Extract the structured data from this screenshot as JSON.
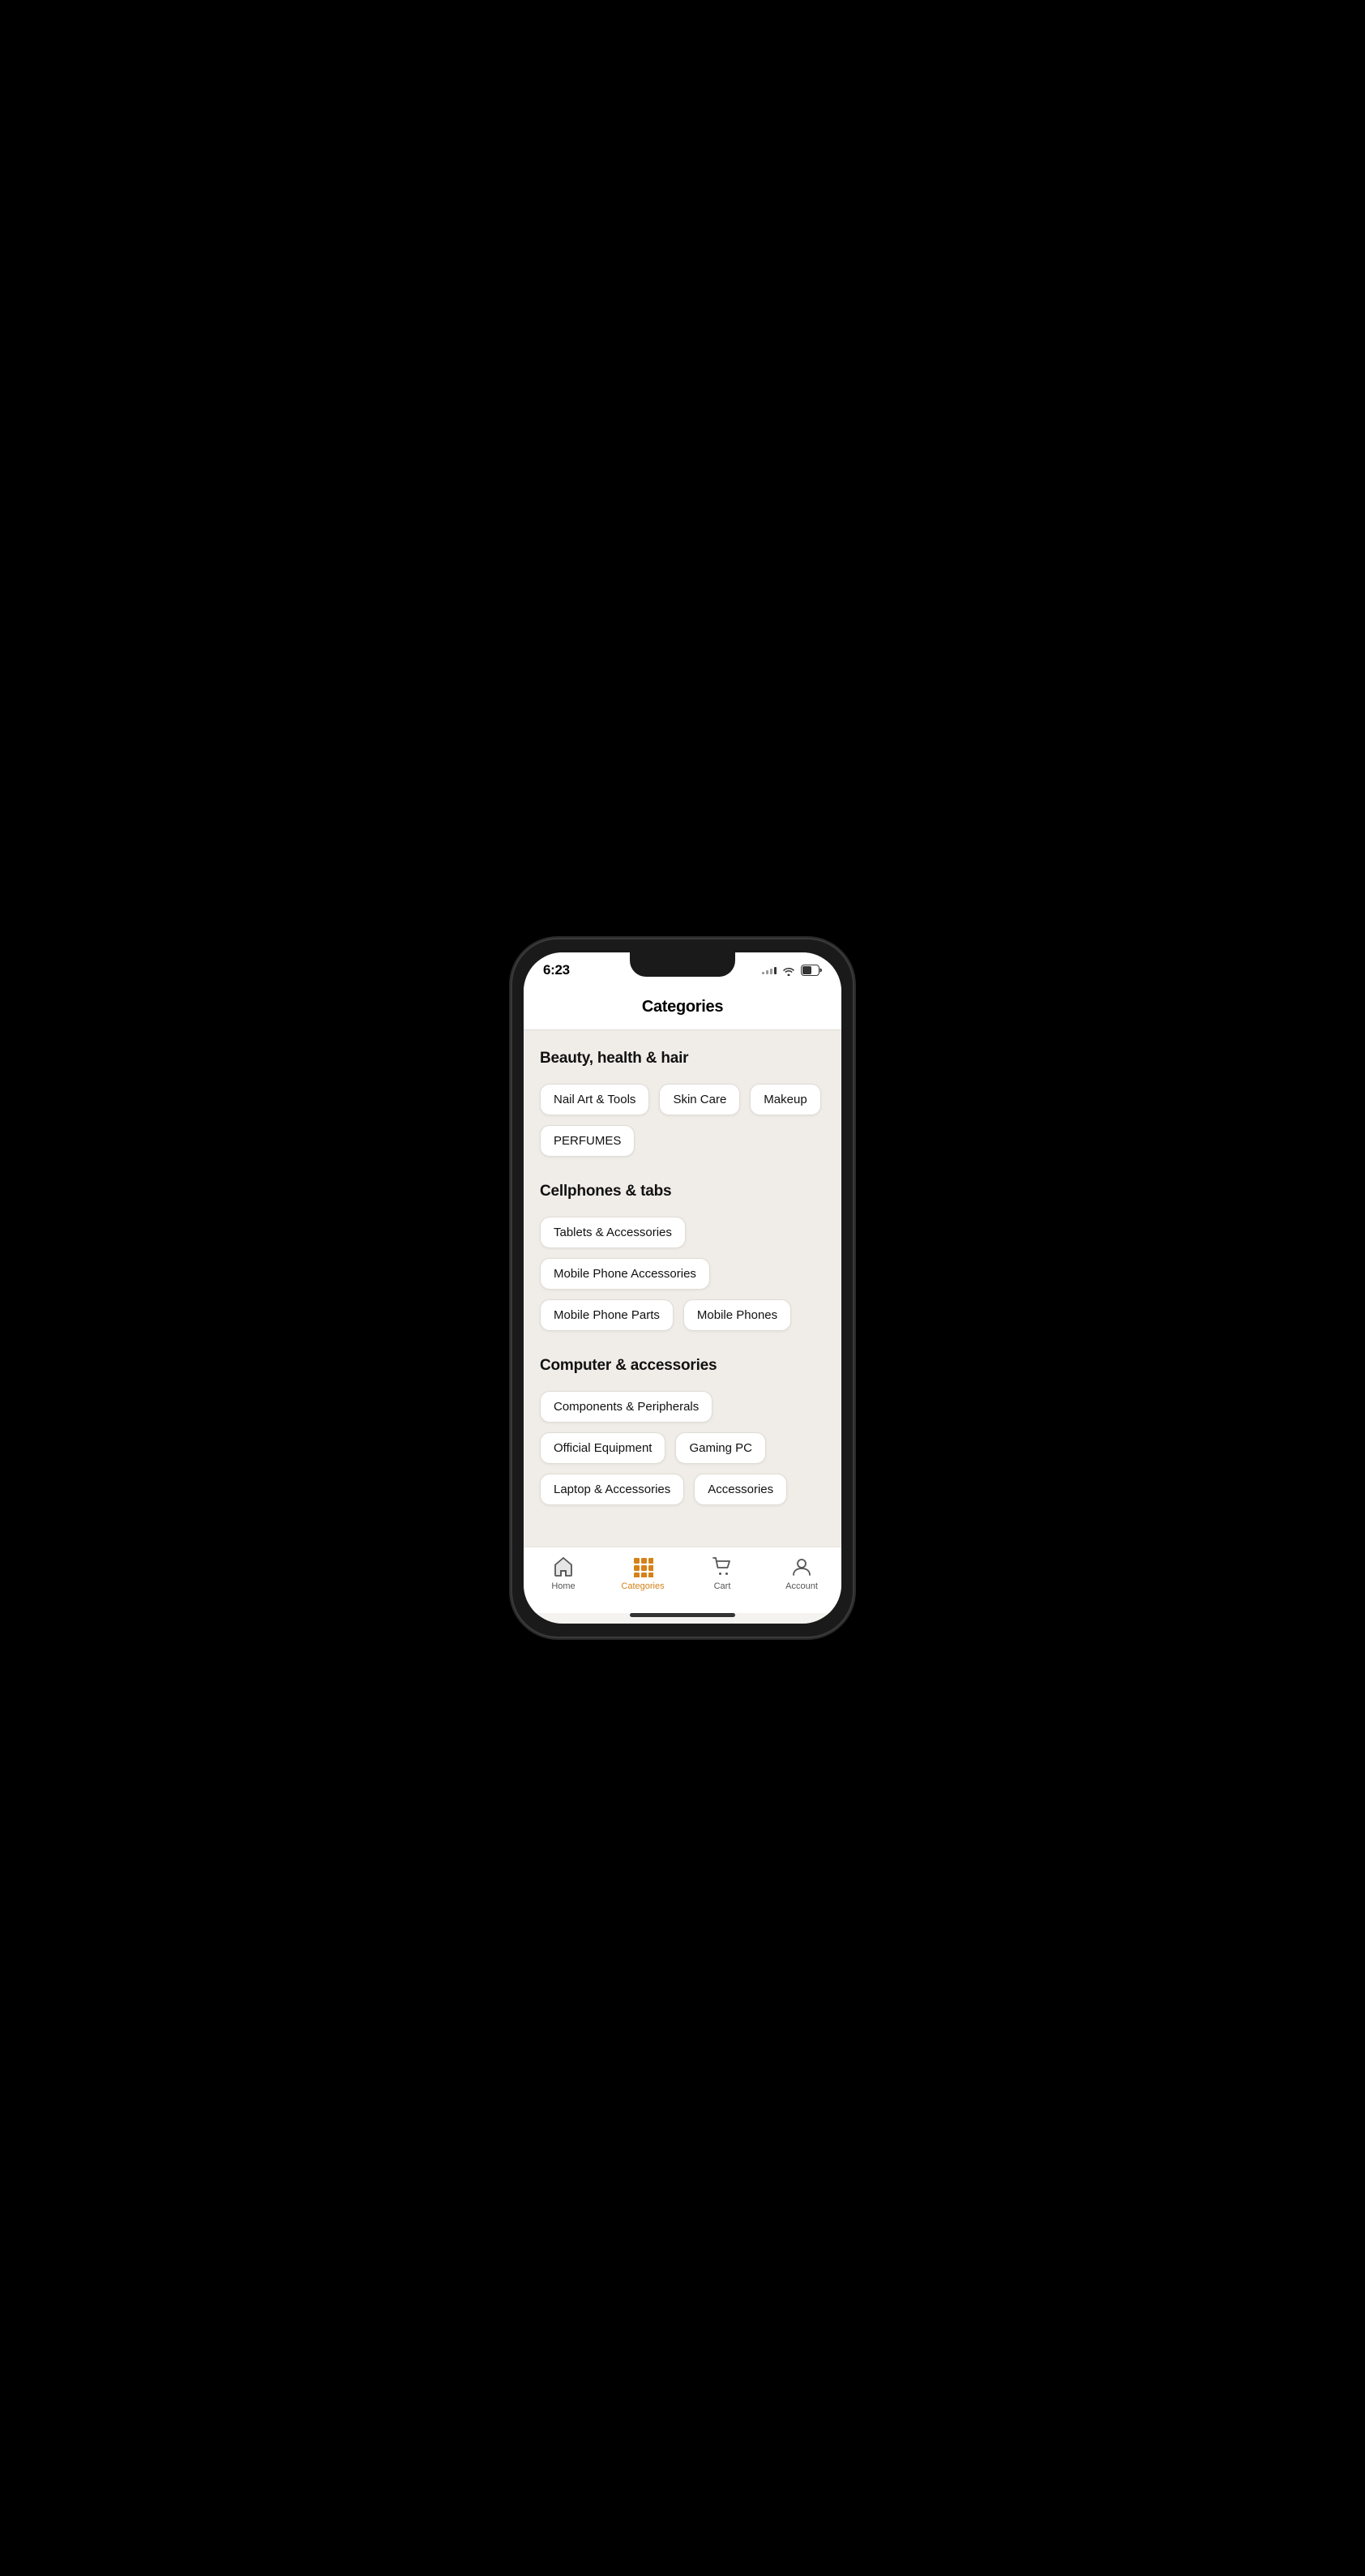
{
  "statusBar": {
    "time": "6:23"
  },
  "header": {
    "title": "Categories"
  },
  "sections": [
    {
      "id": "beauty",
      "title": "Beauty, health & hair",
      "tags": [
        "Nail Art & Tools",
        "Skin Care",
        "Makeup",
        "PERFUMES"
      ]
    },
    {
      "id": "cellphones",
      "title": "Cellphones & tabs",
      "tags": [
        "Tablets & Accessories",
        "Mobile Phone Accessories",
        "Mobile Phone Parts",
        "Mobile Phones"
      ]
    },
    {
      "id": "computers",
      "title": "Computer & accessories",
      "tags": [
        "Components & Peripherals",
        "Official Equipment",
        "Gaming PC",
        "Laptop & Accessories",
        "Accessories"
      ]
    }
  ],
  "bottomNav": {
    "items": [
      {
        "id": "home",
        "label": "Home",
        "active": false
      },
      {
        "id": "categories",
        "label": "Categories",
        "active": true
      },
      {
        "id": "cart",
        "label": "Cart",
        "active": false
      },
      {
        "id": "account",
        "label": "Account",
        "active": false
      }
    ]
  }
}
